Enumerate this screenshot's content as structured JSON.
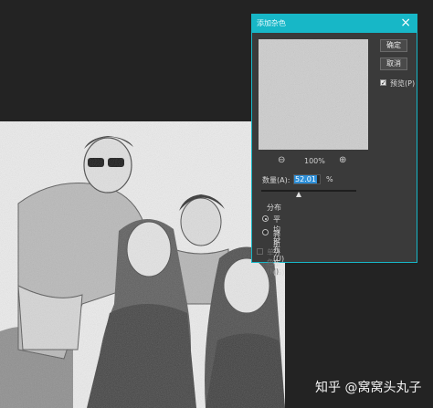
{
  "dialog": {
    "title": "添加杂色",
    "close_icon": "close-icon",
    "ok_label": "确定",
    "cancel_label": "取消",
    "preview_label": "预览(P)",
    "preview_checked": true,
    "zoom_out_icon": "zoom-out-icon",
    "zoom_in_icon": "zoom-in-icon",
    "zoom_level": "100%",
    "amount_label": "数量(A):",
    "amount_value": "52.01",
    "amount_unit": "%",
    "distribution_label": "分布",
    "uniform_label": "平均分布(U)",
    "gaussian_label": "高斯分布(G)",
    "uniform_selected": true,
    "monochrome_label": "单色(M)",
    "monochrome_checked": false,
    "accent_color": "#17b7c7"
  },
  "watermark": {
    "text": "知乎 @窝窝头丸子"
  }
}
